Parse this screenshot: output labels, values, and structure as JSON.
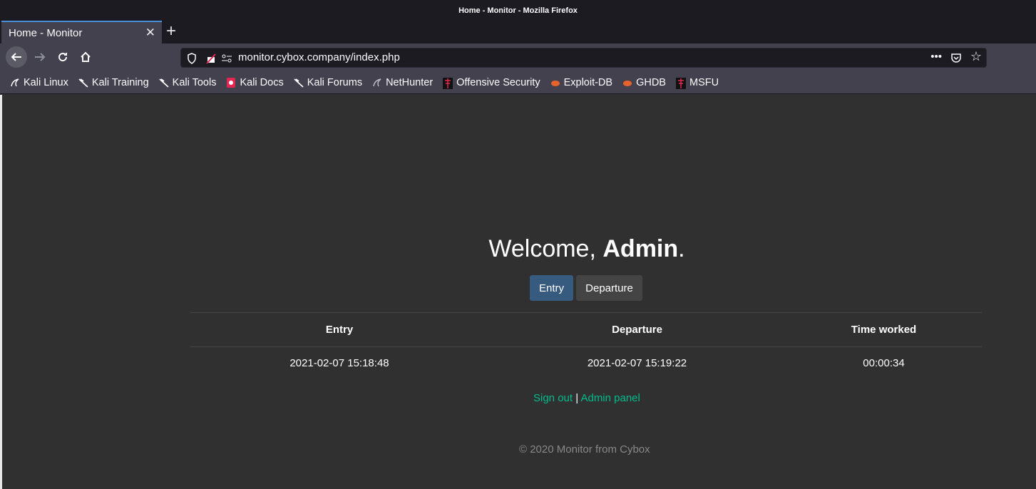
{
  "window": {
    "title": "Home - Monitor - Mozilla Firefox"
  },
  "tab": {
    "title": "Home - Monitor"
  },
  "urlbar": {
    "url": "monitor.cybox.company/index.php"
  },
  "bookmarks": [
    {
      "label": "Kali Linux",
      "icon": "kali-dragon-icon"
    },
    {
      "label": "Kali Training",
      "icon": "kali-dragon-icon"
    },
    {
      "label": "Kali Tools",
      "icon": "kali-dragon-icon"
    },
    {
      "label": "Kali Docs",
      "icon": "kali-docs-icon"
    },
    {
      "label": "Kali Forums",
      "icon": "kali-dragon-icon"
    },
    {
      "label": "NetHunter",
      "icon": "nethunter-icon"
    },
    {
      "label": "Offensive Security",
      "icon": "offsec-icon"
    },
    {
      "label": "Exploit-DB",
      "icon": "exploitdb-icon"
    },
    {
      "label": "GHDB",
      "icon": "exploitdb-icon"
    },
    {
      "label": "MSFU",
      "icon": "offsec-icon"
    }
  ],
  "page": {
    "welcome_prefix": "Welcome, ",
    "welcome_name": "Admin",
    "welcome_suffix": ".",
    "entry_button": "Entry",
    "departure_button": "Departure",
    "table": {
      "headers": [
        "Entry",
        "Departure",
        "Time worked"
      ],
      "rows": [
        [
          "2021-02-07 15:18:48",
          "2021-02-07 15:19:22",
          "00:00:34"
        ]
      ]
    },
    "sign_out": "Sign out",
    "separator": "|",
    "admin_panel": "Admin panel",
    "footer": "© 2020 Monitor from Cybox"
  },
  "colors": {
    "page_bg": "#303030",
    "primary_button": "#375a7f",
    "secondary_button": "#444444",
    "link": "#00bc8c"
  }
}
